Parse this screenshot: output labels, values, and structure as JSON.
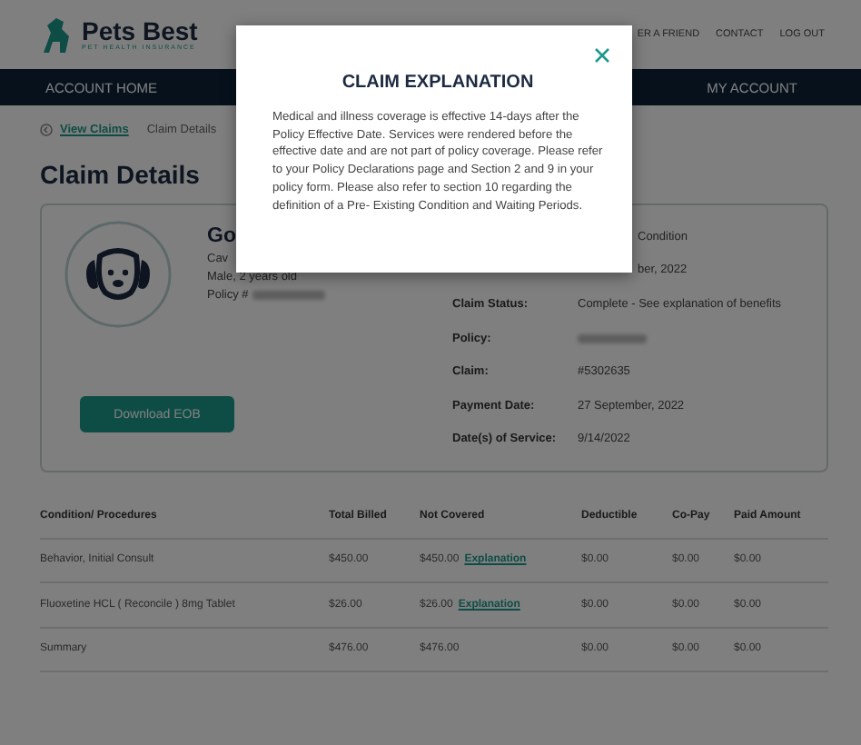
{
  "header": {
    "logo": {
      "name": "Pets Best",
      "tagline": "PET HEALTH INSURANCE"
    },
    "links": [
      "ER A FRIEND",
      "CONTACT",
      "LOG OUT"
    ]
  },
  "nav": [
    "ACCOUNT HOME",
    "MY ACCOUNT"
  ],
  "breadcrumb": {
    "link": "View Claims",
    "current": "Claim Details"
  },
  "heading": "Claim Details",
  "pet": {
    "name": "Go",
    "breed": "Cav",
    "sex_age": "Male, 2 years old",
    "policy_label": "Policy #"
  },
  "download_button": "Download EOB",
  "claim_info": [
    {
      "value": "Condition"
    },
    {
      "value": "ber, 2022"
    },
    {
      "label": "Claim Status:",
      "value": "Complete - See explanation of benefits"
    },
    {
      "label": "Policy:"
    },
    {
      "label": "Claim:",
      "value": "#5302635"
    },
    {
      "label": "Payment Date:",
      "value": "27 September, 2022"
    },
    {
      "label": "Date(s) of Service:",
      "value": "9/14/2022"
    }
  ],
  "table": {
    "columns": [
      "Condition/ Procedures",
      "Total Billed",
      "Not Covered",
      "Deductible",
      "Co-Pay",
      "Paid Amount"
    ],
    "rows": [
      {
        "cells": [
          "Behavior, Initial Consult",
          "$450.00",
          "$450.00",
          "$0.00",
          "$0.00",
          "$0.00"
        ],
        "link": "Explanation"
      },
      {
        "cells": [
          "Fluoxetine HCL ( Reconcile ) 8mg Tablet",
          "$26.00",
          "$26.00",
          "$0.00",
          "$0.00",
          "$0.00"
        ],
        "link": "Explanation"
      },
      {
        "cells": [
          "Summary",
          "$476.00",
          "$476.00",
          "$0.00",
          "$0.00",
          "$0.00"
        ]
      }
    ]
  },
  "modal": {
    "title": "CLAIM EXPLANATION",
    "body": "Medical and illness coverage is effective 14-days after the Policy Effective Date. Services were rendered before the effective date and are not part of policy coverage. Please refer to your Policy Declarations page and Section 2 and 9 in your policy form. Please also refer to section 10 regarding the definition of a Pre- Existing Condition and Waiting Periods."
  }
}
